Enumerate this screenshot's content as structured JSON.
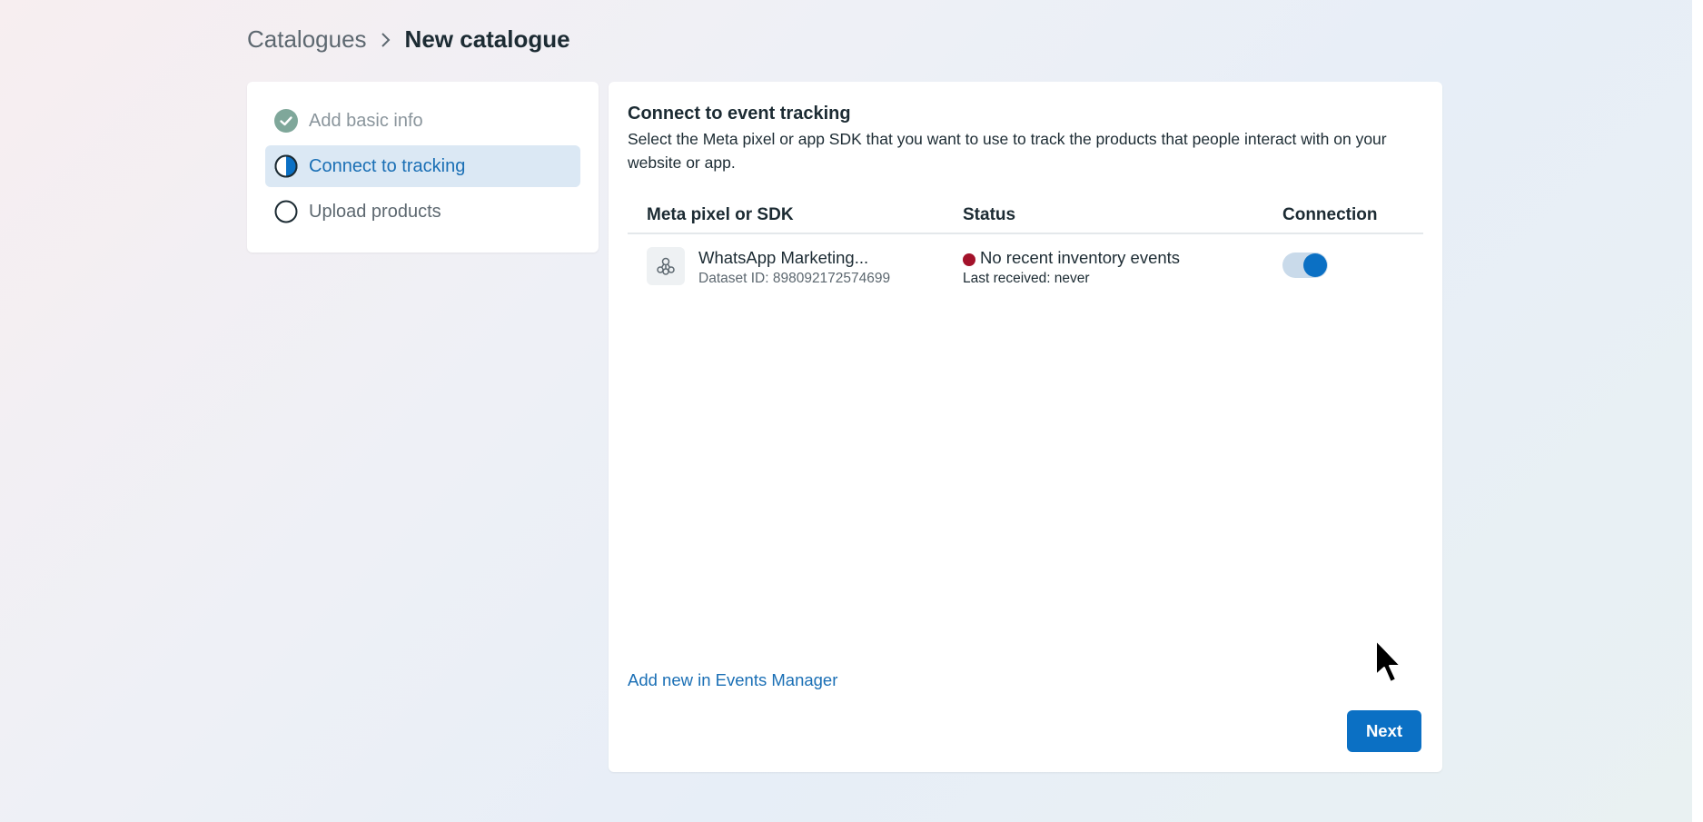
{
  "breadcrumb": {
    "parent": "Catalogues",
    "separator": "chevron-right-icon",
    "current": "New catalogue"
  },
  "steps": [
    {
      "label": "Add basic info",
      "state": "done",
      "icon": "check-circle-icon"
    },
    {
      "label": "Connect to tracking",
      "state": "active",
      "icon": "half-circle-icon"
    },
    {
      "label": "Upload products",
      "state": "todo",
      "icon": "empty-circle-icon"
    }
  ],
  "main": {
    "title": "Connect to event tracking",
    "description": "Select the Meta pixel or app SDK that you want to use to track the products that people interact with on your website or app.",
    "table": {
      "headers": [
        "Meta pixel or SDK",
        "Status",
        "Connection"
      ],
      "rows": [
        {
          "name": "WhatsApp Marketing...",
          "dataset_id": "Dataset ID: 898092172574699",
          "status": "No recent inventory events",
          "status_color": "#a3122a",
          "last_received": "Last received: never",
          "connected": true
        }
      ]
    },
    "add_link": "Add new in Events Manager",
    "next_label": "Next"
  },
  "colors": {
    "accent": "#0b70c4",
    "link": "#1a6fb5",
    "active_step_bg": "#dbe8f4",
    "done_check": "#7fa79a"
  }
}
